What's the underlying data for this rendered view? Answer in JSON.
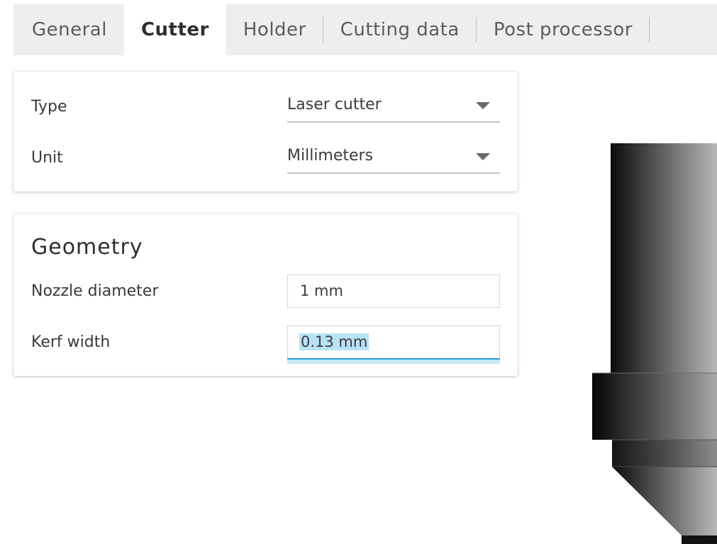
{
  "tabs": [
    {
      "label": "General"
    },
    {
      "label": "Cutter"
    },
    {
      "label": "Holder"
    },
    {
      "label": "Cutting data"
    },
    {
      "label": "Post processor"
    }
  ],
  "active_tab": "Cutter",
  "type_section": {
    "type_label": "Type",
    "type_value": "Laser cutter",
    "unit_label": "Unit",
    "unit_value": "Millimeters"
  },
  "geometry": {
    "title": "Geometry",
    "nozzle_label": "Nozzle diameter",
    "nozzle_value": "1 mm",
    "kerf_label": "Kerf width",
    "kerf_value": "0.13 mm"
  },
  "colors": {
    "tab_bar_bg": "#eeeeee",
    "focus_accent": "#2b9ed6",
    "selection_highlight": "#b9e2f7"
  },
  "icons": {
    "dropdown_caret": "chevron-down-icon",
    "tool_preview": "laser-cutter-tool-preview"
  }
}
